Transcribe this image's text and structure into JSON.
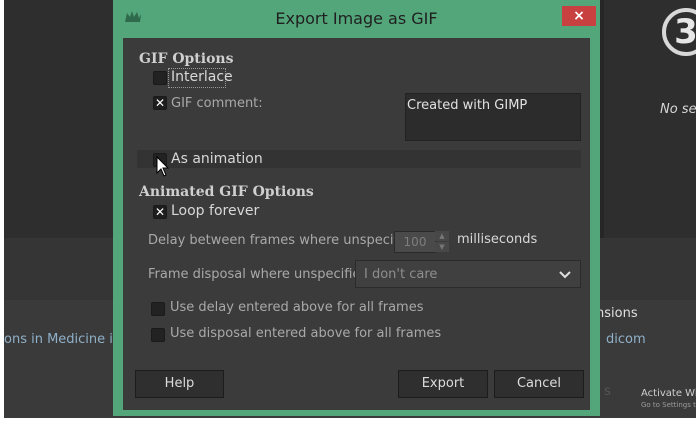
{
  "background": {
    "no_selection_text": "No se",
    "dimensions_text": "nsions",
    "medicine_text": "ons in Medicine in",
    "dicom_text": "dicom",
    "fragment_text": "s",
    "activate": {
      "title": "Activate Windo",
      "subtitle": "Go to Settings to ac"
    },
    "circle_glyph": "3"
  },
  "dialog": {
    "title": "Export Image as GIF",
    "close_label": "×",
    "accent_color": "#53a67a",
    "gif_options": {
      "heading": "GIF Options",
      "interlace": {
        "label": "Interlace",
        "checked": false
      },
      "gif_comment": {
        "label": "GIF comment:",
        "checked": true,
        "value": "Created with GIMP"
      },
      "as_animation": {
        "label": "As animation",
        "checked": false
      }
    },
    "animated_options": {
      "heading": "Animated GIF Options",
      "loop_forever": {
        "label": "Loop forever",
        "checked": true
      },
      "delay_label": "Delay between frames where unspecified:",
      "delay_value": "100",
      "delay_unit": "milliseconds",
      "disposal_label": "Frame disposal where unspecified:",
      "disposal_value": "I don't care",
      "use_delay": {
        "label": "Use delay entered above for all frames",
        "checked": false
      },
      "use_disposal": {
        "label": "Use disposal entered above for all frames",
        "checked": false
      }
    },
    "buttons": {
      "help": "Help",
      "export": "Export",
      "cancel": "Cancel"
    }
  }
}
